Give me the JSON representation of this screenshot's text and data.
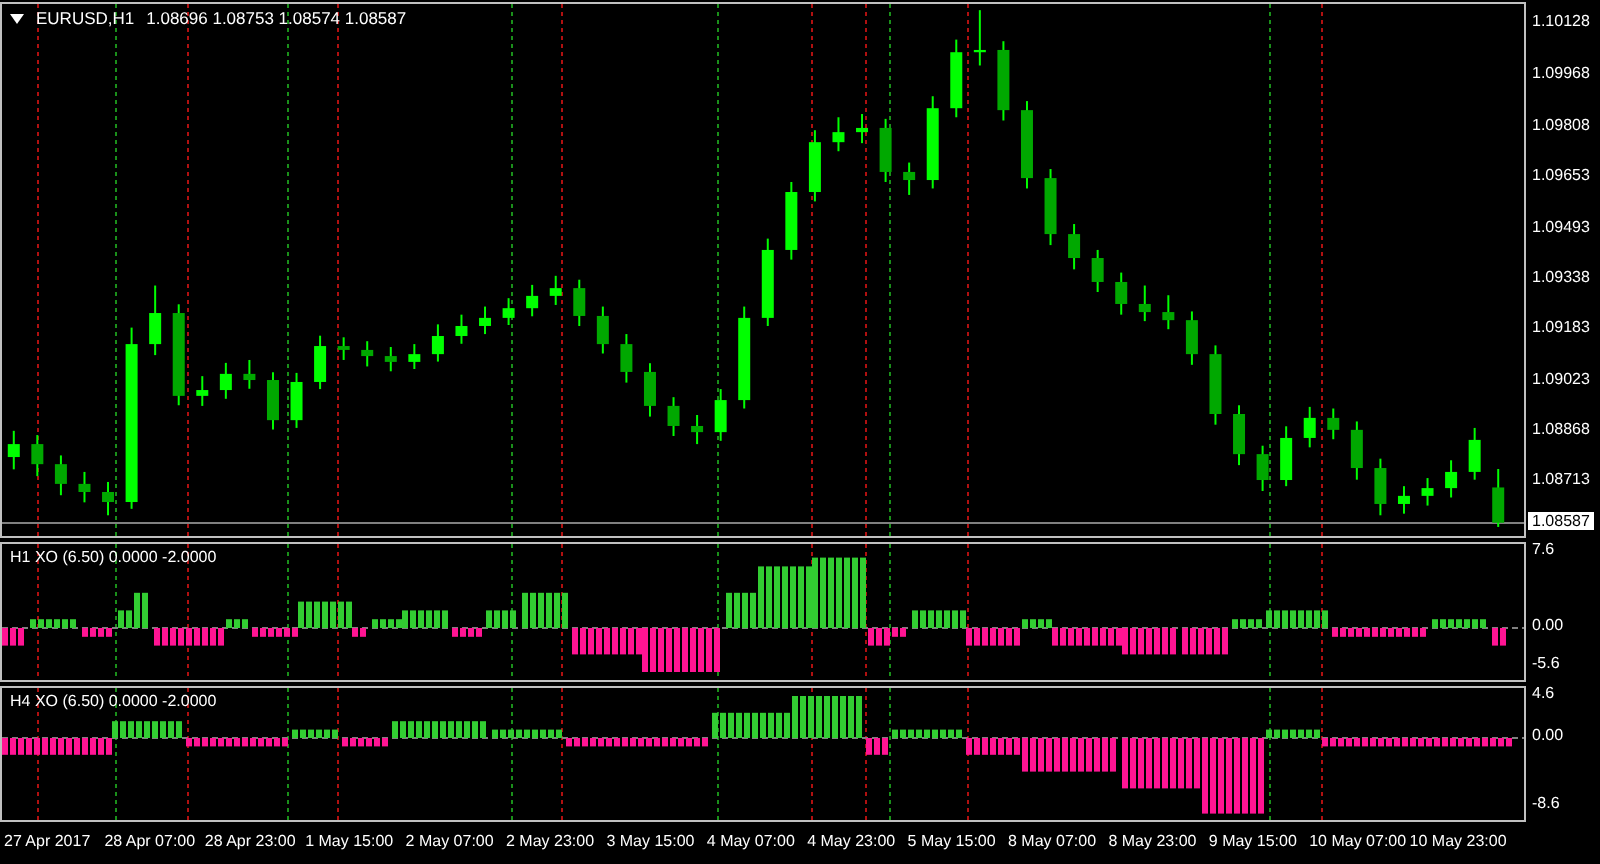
{
  "chart": {
    "symbol": "EURUSD,H1",
    "ohlc": "1.08696 1.08753 1.08574 1.08587",
    "chart_data": {
      "type": "candlestick",
      "grid": true,
      "ref_lines": [
        {
          "axis": "y",
          "value": 1.08587,
          "label": "1.08587"
        }
      ],
      "ylim": [
        1.08546,
        1.1019
      ],
      "yticks": [
        {
          "value": 1.10128,
          "label": "1.10128"
        },
        {
          "value": 1.09968,
          "label": "1.09968"
        },
        {
          "value": 1.09808,
          "label": "1.09808"
        },
        {
          "value": 1.09653,
          "label": "1.09653"
        },
        {
          "value": 1.09493,
          "label": "1.09493"
        },
        {
          "value": 1.09338,
          "label": "1.09338"
        },
        {
          "value": 1.09183,
          "label": "1.09183"
        },
        {
          "value": 1.09023,
          "label": "1.09023"
        },
        {
          "value": 1.08868,
          "label": "1.08868"
        },
        {
          "value": 1.08713,
          "label": "1.08713"
        }
      ],
      "categories": [
        null,
        null,
        null,
        null,
        null,
        null,
        null,
        null,
        null,
        null,
        null,
        null,
        null,
        null,
        null,
        null,
        null,
        null,
        null,
        null,
        null,
        null,
        null,
        null,
        null,
        null,
        null,
        null,
        null,
        null,
        null,
        null,
        null,
        null,
        null,
        null,
        null,
        null,
        null,
        null,
        null,
        null,
        null,
        null,
        null,
        null,
        null,
        null,
        null,
        null,
        null,
        null,
        null,
        null,
        null,
        null,
        null,
        null,
        null,
        null,
        null,
        null,
        null,
        null
      ],
      "ohlc": [
        [
          1.0879,
          1.08871,
          1.08752,
          1.0883
        ],
        [
          1.0883,
          1.08858,
          1.08731,
          1.08768
        ],
        [
          1.08768,
          1.08795,
          1.08672,
          1.08707
        ],
        [
          1.08707,
          1.08744,
          1.0865,
          1.08682
        ],
        [
          1.08682,
          1.08713,
          1.0861,
          1.08651
        ],
        [
          1.08651,
          1.0919,
          1.0863,
          1.09139
        ],
        [
          1.09139,
          1.0932,
          1.09105,
          1.09235
        ],
        [
          1.09235,
          1.09262,
          1.0895,
          1.08979
        ],
        [
          1.08979,
          1.0904,
          1.08948,
          1.08997
        ],
        [
          1.08997,
          1.09081,
          1.0897,
          1.09047
        ],
        [
          1.09047,
          1.0909,
          1.09001,
          1.09028
        ],
        [
          1.09028,
          1.09052,
          1.08875,
          1.08904
        ],
        [
          1.08904,
          1.0905,
          1.0888,
          1.09022
        ],
        [
          1.09022,
          1.09165,
          1.09,
          1.09133
        ],
        [
          1.09133,
          1.0916,
          1.0909,
          1.09121
        ],
        [
          1.09121,
          1.09148,
          1.0907,
          1.09102
        ],
        [
          1.09102,
          1.0913,
          1.09055,
          1.09084
        ],
        [
          1.09084,
          1.09139,
          1.09062,
          1.09108
        ],
        [
          1.09108,
          1.092,
          1.09085,
          1.09164
        ],
        [
          1.09164,
          1.0923,
          1.0914,
          1.09195
        ],
        [
          1.09195,
          1.09255,
          1.0917,
          1.0922
        ],
        [
          1.0922,
          1.09281,
          1.09198,
          1.0925
        ],
        [
          1.0925,
          1.09322,
          1.09225,
          1.09288
        ],
        [
          1.09288,
          1.0935,
          1.0926,
          1.09312
        ],
        [
          1.09312,
          1.09338,
          1.09195,
          1.09226
        ],
        [
          1.09226,
          1.09255,
          1.0911,
          1.09139
        ],
        [
          1.09139,
          1.0917,
          1.0902,
          1.09053
        ],
        [
          1.09053,
          1.0908,
          1.08915,
          1.08948
        ],
        [
          1.08948,
          1.08975,
          1.08855,
          1.08886
        ],
        [
          1.08886,
          1.0892,
          1.0883,
          1.08867
        ],
        [
          1.08867,
          1.09,
          1.0884,
          1.08966
        ],
        [
          1.08966,
          1.09255,
          1.0894,
          1.0922
        ],
        [
          1.0922,
          1.09465,
          1.09195,
          1.0943
        ],
        [
          1.0943,
          1.0964,
          1.094,
          1.09609
        ],
        [
          1.09609,
          1.098,
          1.0958,
          1.09763
        ],
        [
          1.09763,
          1.0984,
          1.09735,
          1.09794
        ],
        [
          1.09794,
          1.0985,
          1.0976,
          1.09807
        ],
        [
          1.09807,
          1.09835,
          1.0964,
          1.09671
        ],
        [
          1.09671,
          1.097,
          1.096,
          1.09646
        ],
        [
          1.09646,
          1.09905,
          1.0962,
          1.09868
        ],
        [
          1.09868,
          1.1008,
          1.0984,
          1.10041
        ],
        [
          1.10041,
          1.10171,
          1.1,
          1.10048
        ],
        [
          1.10048,
          1.10075,
          1.0983,
          1.09862
        ],
        [
          1.09862,
          1.0989,
          1.0962,
          1.09652
        ],
        [
          1.09652,
          1.0968,
          1.09445,
          1.09479
        ],
        [
          1.09479,
          1.0951,
          1.0937,
          1.09405
        ],
        [
          1.09405,
          1.0943,
          1.093,
          1.09331
        ],
        [
          1.09331,
          1.0936,
          1.0923,
          1.09263
        ],
        [
          1.09263,
          1.0932,
          1.0921,
          1.09238
        ],
        [
          1.09238,
          1.0929,
          1.09185,
          1.09213
        ],
        [
          1.09213,
          1.0924,
          1.09075,
          1.09108
        ],
        [
          1.09108,
          1.09135,
          1.0889,
          1.08923
        ],
        [
          1.08923,
          1.0895,
          1.08765,
          1.08799
        ],
        [
          1.08799,
          1.08825,
          1.08685,
          1.08719
        ],
        [
          1.08719,
          1.08885,
          1.087,
          1.08849
        ],
        [
          1.08849,
          1.08945,
          1.0882,
          1.08911
        ],
        [
          1.08911,
          1.0894,
          1.08845,
          1.08874
        ],
        [
          1.08874,
          1.089,
          1.0872,
          1.08756
        ],
        [
          1.08756,
          1.08785,
          1.0861,
          1.08645
        ],
        [
          1.08645,
          1.087,
          1.08615,
          1.0867
        ],
        [
          1.0867,
          1.08725,
          1.0864,
          1.08694
        ],
        [
          1.08694,
          1.0878,
          1.08665,
          1.08744
        ],
        [
          1.08744,
          1.0888,
          1.0872,
          1.08843
        ],
        [
          1.08696,
          1.08753,
          1.08574,
          1.08587
        ]
      ]
    }
  },
  "indicators": [
    {
      "label": "H1 XO (6.50) 0.0000 -2.0000",
      "scale": [
        "7.6",
        "0.00",
        "-5.6"
      ]
    },
    {
      "label": "H4 XO (6.50) 0.0000 -2.0000",
      "scale": [
        "4.6",
        "0.00",
        "-8.6"
      ]
    }
  ],
  "time_axis": [
    "27 Apr 2017",
    "28 Apr 07:00",
    "28 Apr 23:00",
    "1 May 15:00",
    "2 May 07:00",
    "2 May 23:00",
    "3 May 15:00",
    "4 May 07:00",
    "4 May 23:00",
    "5 May 15:00",
    "8 May 07:00",
    "8 May 23:00",
    "9 May 15:00",
    "10 May 07:00",
    "10 May 23:00"
  ]
}
